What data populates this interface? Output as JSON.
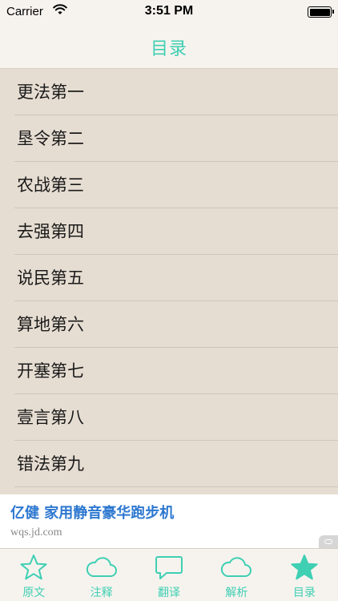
{
  "status_bar": {
    "carrier": "Carrier",
    "time": "3:51 PM"
  },
  "nav": {
    "title": "目录"
  },
  "list": {
    "items": [
      "更法第一",
      "垦令第二",
      "农战第三",
      "去强第四",
      "说民第五",
      "算地第六",
      "开塞第七",
      "壹言第八",
      "错法第九"
    ]
  },
  "ad": {
    "title": "亿健 家用静音豪华跑步机",
    "url": "wqs.jd.com"
  },
  "tab_bar": {
    "accent_color": "#3fcfb3",
    "tabs": [
      {
        "label": "原文",
        "icon": "star-outline-icon"
      },
      {
        "label": "注释",
        "icon": "cloud-icon"
      },
      {
        "label": "翻译",
        "icon": "speech-bubble-icon"
      },
      {
        "label": "解析",
        "icon": "cloud-icon"
      },
      {
        "label": "目录",
        "icon": "star-filled-icon"
      }
    ],
    "selected": "目录"
  }
}
